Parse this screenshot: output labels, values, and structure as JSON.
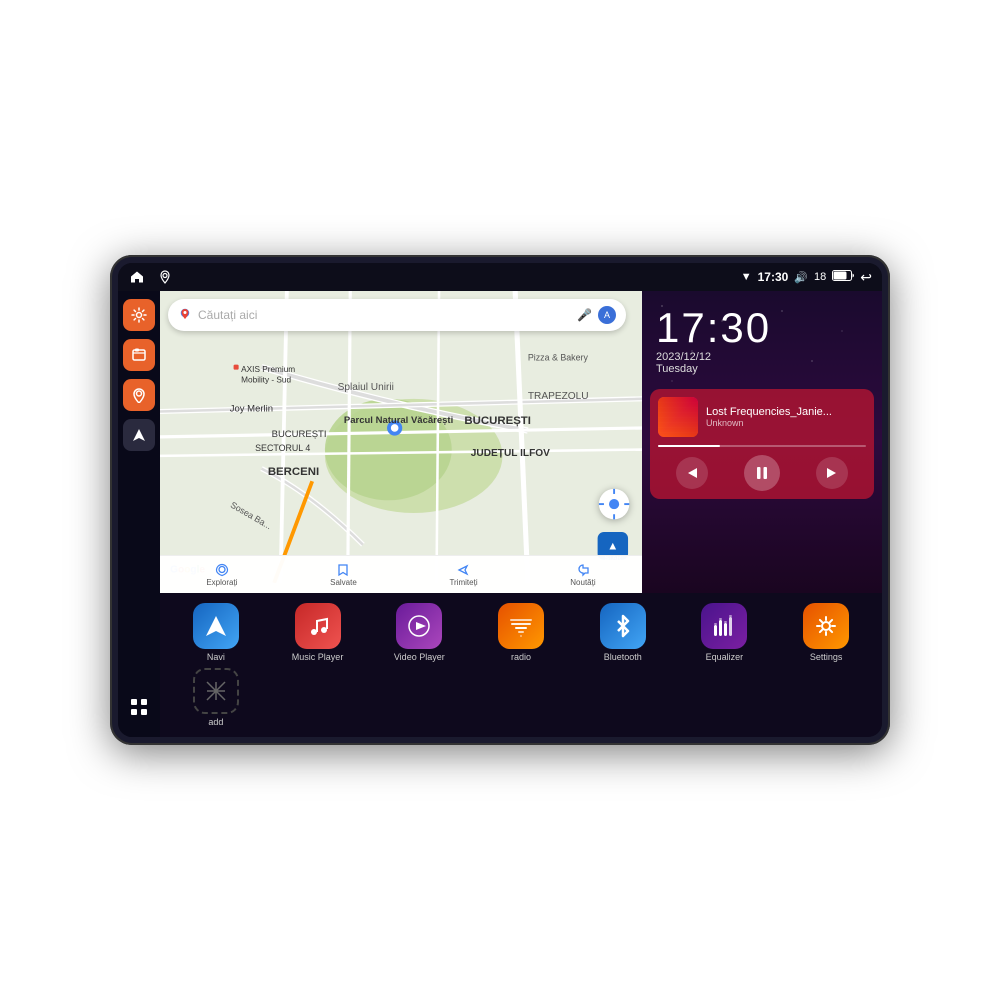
{
  "device": {
    "status_bar": {
      "wifi_icon": "▼",
      "time": "17:30",
      "volume_icon": "🔊",
      "battery_num": "18",
      "battery_icon": "🔋",
      "back_icon": "↩"
    },
    "sidebar": {
      "buttons": [
        {
          "id": "settings",
          "icon": "⚙",
          "color": "orange",
          "label": "Settings"
        },
        {
          "id": "files",
          "icon": "■",
          "color": "orange",
          "label": "Files"
        },
        {
          "id": "maps",
          "icon": "◉",
          "color": "orange",
          "label": "Maps"
        },
        {
          "id": "navigation",
          "icon": "▲",
          "color": "dark",
          "label": "Navigation"
        }
      ],
      "grid_icon": "⋮⋮⋮"
    },
    "map": {
      "search_placeholder": "Căutați aici",
      "places": [
        "AXIS Premium Mobility - Sud",
        "Pizza & Bakery",
        "Parcul Natural Văcărești",
        "BUCUREȘTI SECTORUL 4",
        "BUCUREȘTI",
        "JUDEȚUL ILFOV",
        "BERCENI",
        "Joy Merlin"
      ],
      "bottom_nav": [
        {
          "icon": "🔍",
          "label": "Explorați"
        },
        {
          "icon": "🔖",
          "label": "Salvate"
        },
        {
          "icon": "↗",
          "label": "Trimiteți"
        },
        {
          "icon": "🔔",
          "label": "Noutăți"
        }
      ]
    },
    "clock": {
      "time": "17:30",
      "date": "2023/12/12",
      "day": "Tuesday"
    },
    "music_player": {
      "title": "Lost Frequencies_Janie...",
      "artist": "Unknown",
      "controls": {
        "prev": "⏮",
        "play": "⏸",
        "next": "⏭"
      }
    },
    "apps": [
      {
        "id": "navi",
        "label": "Navi",
        "icon_class": "blue-nav",
        "symbol": "▲"
      },
      {
        "id": "music-player",
        "label": "Music Player",
        "icon_class": "red-music",
        "symbol": "♪"
      },
      {
        "id": "video-player",
        "label": "Video Player",
        "icon_class": "purple-video",
        "symbol": "▶"
      },
      {
        "id": "radio",
        "label": "radio",
        "icon_class": "orange-radio",
        "symbol": "📻"
      },
      {
        "id": "bluetooth",
        "label": "Bluetooth",
        "icon_class": "blue-bt",
        "symbol": "⚡"
      },
      {
        "id": "equalizer",
        "label": "Equalizer",
        "icon_class": "purple-eq",
        "symbol": "🎚"
      },
      {
        "id": "settings",
        "label": "Settings",
        "icon_class": "orange-settings",
        "symbol": "⚙"
      },
      {
        "id": "add",
        "label": "add",
        "icon_class": "gray-add",
        "symbol": "+"
      }
    ]
  }
}
